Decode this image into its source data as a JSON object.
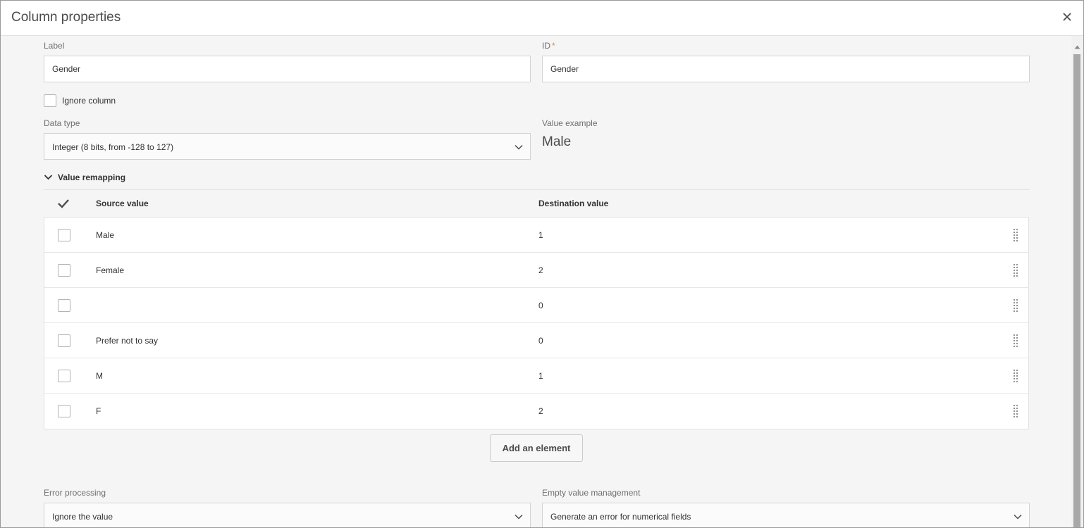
{
  "dialog": {
    "title": "Column properties",
    "close_icon": "close-icon"
  },
  "label_field": {
    "label": "Label",
    "value": "Gender"
  },
  "id_field": {
    "label": "ID",
    "required_mark": "*",
    "value": "Gender"
  },
  "ignore_column": {
    "label": "Ignore column",
    "checked": false
  },
  "data_type": {
    "label": "Data type",
    "value": "Integer (8 bits, from -128 to 127)"
  },
  "value_example": {
    "label": "Value example",
    "value": "Male"
  },
  "remapping": {
    "title": "Value remapping",
    "expanded": true,
    "columns": {
      "source": "Source value",
      "destination": "Destination value"
    },
    "rows": [
      {
        "source": "Male",
        "destination": "1"
      },
      {
        "source": "Female",
        "destination": "2"
      },
      {
        "source": "",
        "destination": "0"
      },
      {
        "source": "Prefer not to say",
        "destination": "0"
      },
      {
        "source": "M",
        "destination": "1"
      },
      {
        "source": "F",
        "destination": "2"
      }
    ],
    "add_button": "Add an element"
  },
  "error_processing": {
    "label": "Error processing",
    "value": "Ignore the value"
  },
  "empty_value": {
    "label": "Empty value management",
    "value": "Generate an error for numerical fields"
  },
  "colors": {
    "accent_required": "#e68619",
    "text": "#323232",
    "muted": "#707070"
  }
}
